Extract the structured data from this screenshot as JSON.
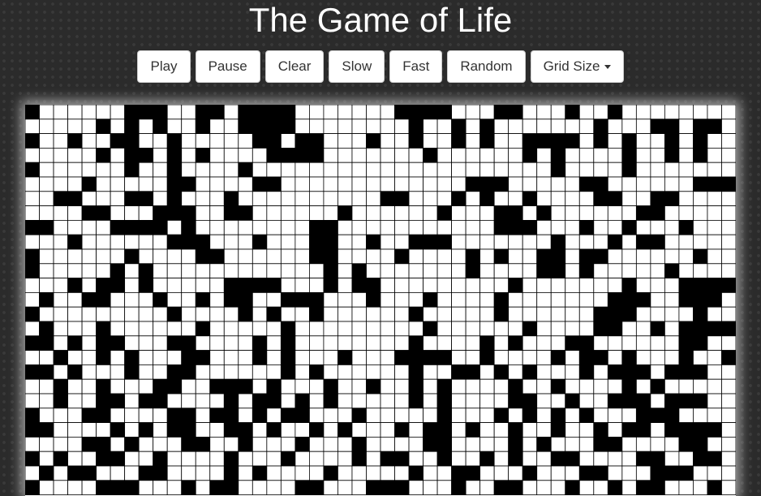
{
  "title": "The Game of Life",
  "toolbar": {
    "play": "Play",
    "pause": "Pause",
    "clear": "Clear",
    "slow": "Slow",
    "fast": "Fast",
    "random": "Random",
    "grid_size": "Grid Size"
  },
  "colors": {
    "background": "#2b2b2b",
    "cell_alive": "#000000",
    "cell_dead": "#ffffff",
    "grid_line": "#000000"
  },
  "board": {
    "cols": 50,
    "visible_rows": 27,
    "alive_cells": [
      [
        0,
        0
      ],
      [
        0,
        7
      ],
      [
        0,
        8
      ],
      [
        0,
        9
      ],
      [
        0,
        12
      ],
      [
        0,
        13
      ],
      [
        0,
        15
      ],
      [
        0,
        16
      ],
      [
        0,
        17
      ],
      [
        0,
        18
      ],
      [
        0,
        26
      ],
      [
        0,
        27
      ],
      [
        0,
        28
      ],
      [
        0,
        29
      ],
      [
        0,
        33
      ],
      [
        0,
        34
      ],
      [
        0,
        38
      ],
      [
        0,
        41
      ],
      [
        1,
        5
      ],
      [
        1,
        7
      ],
      [
        1,
        9
      ],
      [
        1,
        12
      ],
      [
        1,
        15
      ],
      [
        1,
        16
      ],
      [
        1,
        17
      ],
      [
        1,
        18
      ],
      [
        1,
        27
      ],
      [
        1,
        30
      ],
      [
        1,
        32
      ],
      [
        1,
        40
      ],
      [
        1,
        44
      ],
      [
        1,
        45
      ],
      [
        1,
        47
      ],
      [
        1,
        48
      ],
      [
        2,
        0
      ],
      [
        2,
        3
      ],
      [
        2,
        6
      ],
      [
        2,
        7
      ],
      [
        2,
        10
      ],
      [
        2,
        16
      ],
      [
        2,
        17
      ],
      [
        2,
        19
      ],
      [
        2,
        20
      ],
      [
        2,
        24
      ],
      [
        2,
        27
      ],
      [
        2,
        30
      ],
      [
        2,
        32
      ],
      [
        2,
        35
      ],
      [
        2,
        36
      ],
      [
        2,
        37
      ],
      [
        2,
        38
      ],
      [
        2,
        40
      ],
      [
        2,
        42
      ],
      [
        2,
        45
      ],
      [
        2,
        47
      ],
      [
        3,
        5
      ],
      [
        3,
        7
      ],
      [
        3,
        8
      ],
      [
        3,
        10
      ],
      [
        3,
        12
      ],
      [
        3,
        17
      ],
      [
        3,
        18
      ],
      [
        3,
        19
      ],
      [
        3,
        20
      ],
      [
        3,
        28
      ],
      [
        3,
        35
      ],
      [
        3,
        37
      ],
      [
        3,
        42
      ],
      [
        3,
        45
      ],
      [
        3,
        47
      ],
      [
        4,
        0
      ],
      [
        4,
        7
      ],
      [
        4,
        10
      ],
      [
        4,
        15
      ],
      [
        4,
        37
      ],
      [
        4,
        42
      ],
      [
        5,
        4
      ],
      [
        5,
        10
      ],
      [
        5,
        11
      ],
      [
        5,
        16
      ],
      [
        5,
        17
      ],
      [
        5,
        31
      ],
      [
        5,
        32
      ],
      [
        5,
        33
      ],
      [
        5,
        39
      ],
      [
        5,
        40
      ],
      [
        5,
        47
      ],
      [
        5,
        48
      ],
      [
        5,
        49
      ],
      [
        6,
        2
      ],
      [
        6,
        3
      ],
      [
        6,
        7
      ],
      [
        6,
        8
      ],
      [
        6,
        10
      ],
      [
        6,
        14
      ],
      [
        6,
        25
      ],
      [
        6,
        26
      ],
      [
        6,
        30
      ],
      [
        6,
        32
      ],
      [
        6,
        35
      ],
      [
        6,
        40
      ],
      [
        6,
        41
      ],
      [
        6,
        44
      ],
      [
        6,
        45
      ],
      [
        7,
        4
      ],
      [
        7,
        5
      ],
      [
        7,
        9
      ],
      [
        7,
        10
      ],
      [
        7,
        11
      ],
      [
        7,
        14
      ],
      [
        7,
        15
      ],
      [
        7,
        22
      ],
      [
        7,
        29
      ],
      [
        7,
        33
      ],
      [
        7,
        34
      ],
      [
        7,
        36
      ],
      [
        7,
        43
      ],
      [
        7,
        44
      ],
      [
        8,
        0
      ],
      [
        8,
        1
      ],
      [
        8,
        6
      ],
      [
        8,
        7
      ],
      [
        8,
        8
      ],
      [
        8,
        9
      ],
      [
        8,
        11
      ],
      [
        8,
        20
      ],
      [
        8,
        21
      ],
      [
        8,
        33
      ],
      [
        8,
        34
      ],
      [
        8,
        35
      ],
      [
        8,
        39
      ],
      [
        8,
        42
      ],
      [
        8,
        46
      ],
      [
        9,
        3
      ],
      [
        9,
        10
      ],
      [
        9,
        11
      ],
      [
        9,
        12
      ],
      [
        9,
        16
      ],
      [
        9,
        20
      ],
      [
        9,
        21
      ],
      [
        9,
        24
      ],
      [
        9,
        27
      ],
      [
        9,
        28
      ],
      [
        9,
        29
      ],
      [
        9,
        37
      ],
      [
        9,
        41
      ],
      [
        9,
        43
      ],
      [
        9,
        44
      ],
      [
        10,
        0
      ],
      [
        10,
        7
      ],
      [
        10,
        12
      ],
      [
        10,
        13
      ],
      [
        10,
        20
      ],
      [
        10,
        21
      ],
      [
        10,
        26
      ],
      [
        10,
        31
      ],
      [
        10,
        33
      ],
      [
        10,
        36
      ],
      [
        10,
        37
      ],
      [
        10,
        39
      ],
      [
        10,
        40
      ],
      [
        10,
        47
      ],
      [
        11,
        0
      ],
      [
        11,
        6
      ],
      [
        11,
        8
      ],
      [
        11,
        21
      ],
      [
        11,
        23
      ],
      [
        11,
        31
      ],
      [
        11,
        36
      ],
      [
        11,
        37
      ],
      [
        11,
        39
      ],
      [
        11,
        45
      ],
      [
        12,
        3
      ],
      [
        12,
        5
      ],
      [
        12,
        6
      ],
      [
        12,
        8
      ],
      [
        12,
        14
      ],
      [
        12,
        15
      ],
      [
        12,
        16
      ],
      [
        12,
        17
      ],
      [
        12,
        21
      ],
      [
        12,
        23
      ],
      [
        12,
        24
      ],
      [
        12,
        34
      ],
      [
        12,
        42
      ],
      [
        12,
        46
      ],
      [
        12,
        47
      ],
      [
        12,
        48
      ],
      [
        12,
        49
      ],
      [
        13,
        1
      ],
      [
        13,
        4
      ],
      [
        13,
        5
      ],
      [
        13,
        9
      ],
      [
        13,
        12
      ],
      [
        13,
        14
      ],
      [
        13,
        15
      ],
      [
        13,
        18
      ],
      [
        13,
        19
      ],
      [
        13,
        20
      ],
      [
        13,
        24
      ],
      [
        13,
        28
      ],
      [
        13,
        33
      ],
      [
        13,
        41
      ],
      [
        13,
        42
      ],
      [
        13,
        43
      ],
      [
        13,
        46
      ],
      [
        13,
        47
      ],
      [
        13,
        48
      ],
      [
        14,
        0
      ],
      [
        14,
        10
      ],
      [
        14,
        15
      ],
      [
        14,
        17
      ],
      [
        14,
        20
      ],
      [
        14,
        27
      ],
      [
        14,
        33
      ],
      [
        14,
        40
      ],
      [
        14,
        41
      ],
      [
        14,
        42
      ],
      [
        14,
        47
      ],
      [
        15,
        1
      ],
      [
        15,
        5
      ],
      [
        15,
        12
      ],
      [
        15,
        18
      ],
      [
        15,
        28
      ],
      [
        15,
        35
      ],
      [
        15,
        40
      ],
      [
        15,
        41
      ],
      [
        15,
        44
      ],
      [
        15,
        46
      ],
      [
        15,
        47
      ],
      [
        15,
        48
      ],
      [
        15,
        49
      ],
      [
        16,
        0
      ],
      [
        16,
        1
      ],
      [
        16,
        3
      ],
      [
        16,
        5
      ],
      [
        16,
        6
      ],
      [
        16,
        10
      ],
      [
        16,
        11
      ],
      [
        16,
        16
      ],
      [
        16,
        18
      ],
      [
        16,
        27
      ],
      [
        16,
        32
      ],
      [
        16,
        34
      ],
      [
        16,
        38
      ],
      [
        16,
        39
      ],
      [
        16,
        46
      ],
      [
        16,
        47
      ],
      [
        17,
        2
      ],
      [
        17,
        5
      ],
      [
        17,
        7
      ],
      [
        17,
        11
      ],
      [
        17,
        12
      ],
      [
        17,
        16
      ],
      [
        17,
        18
      ],
      [
        17,
        22
      ],
      [
        17,
        26
      ],
      [
        17,
        27
      ],
      [
        17,
        28
      ],
      [
        17,
        29
      ],
      [
        17,
        32
      ],
      [
        17,
        37
      ],
      [
        17,
        39
      ],
      [
        17,
        40
      ],
      [
        17,
        42
      ],
      [
        17,
        46
      ],
      [
        17,
        49
      ],
      [
        18,
        0
      ],
      [
        18,
        1
      ],
      [
        18,
        3
      ],
      [
        18,
        7
      ],
      [
        18,
        10
      ],
      [
        18,
        11
      ],
      [
        18,
        18
      ],
      [
        18,
        20
      ],
      [
        18,
        27
      ],
      [
        18,
        30
      ],
      [
        18,
        31
      ],
      [
        18,
        33
      ],
      [
        18,
        35
      ],
      [
        18,
        39
      ],
      [
        18,
        41
      ],
      [
        18,
        42
      ],
      [
        18,
        43
      ],
      [
        18,
        45
      ],
      [
        18,
        46
      ],
      [
        18,
        47
      ],
      [
        19,
        2
      ],
      [
        19,
        5
      ],
      [
        19,
        9
      ],
      [
        19,
        10
      ],
      [
        19,
        13
      ],
      [
        19,
        14
      ],
      [
        19,
        15
      ],
      [
        19,
        17
      ],
      [
        19,
        21
      ],
      [
        19,
        24
      ],
      [
        19,
        27
      ],
      [
        19,
        29
      ],
      [
        19,
        34
      ],
      [
        19,
        37
      ],
      [
        19,
        42
      ],
      [
        19,
        44
      ],
      [
        20,
        2
      ],
      [
        20,
        5
      ],
      [
        20,
        6
      ],
      [
        20,
        8
      ],
      [
        20,
        9
      ],
      [
        20,
        14
      ],
      [
        20,
        16
      ],
      [
        20,
        17
      ],
      [
        20,
        19
      ],
      [
        20,
        21
      ],
      [
        20,
        27
      ],
      [
        20,
        29
      ],
      [
        20,
        34
      ],
      [
        20,
        35
      ],
      [
        20,
        38
      ],
      [
        20,
        41
      ],
      [
        20,
        42
      ],
      [
        20,
        43
      ],
      [
        20,
        45
      ],
      [
        20,
        46
      ],
      [
        20,
        47
      ],
      [
        21,
        0
      ],
      [
        21,
        4
      ],
      [
        21,
        5
      ],
      [
        21,
        10
      ],
      [
        21,
        11
      ],
      [
        21,
        13
      ],
      [
        21,
        14
      ],
      [
        21,
        16
      ],
      [
        21,
        18
      ],
      [
        21,
        19
      ],
      [
        21,
        23
      ],
      [
        21,
        29
      ],
      [
        21,
        33
      ],
      [
        21,
        35
      ],
      [
        21,
        37
      ],
      [
        21,
        39
      ],
      [
        21,
        43
      ],
      [
        21,
        44
      ],
      [
        21,
        45
      ],
      [
        22,
        0
      ],
      [
        22,
        1
      ],
      [
        22,
        6
      ],
      [
        22,
        8
      ],
      [
        22,
        10
      ],
      [
        22,
        11
      ],
      [
        22,
        14
      ],
      [
        22,
        15
      ],
      [
        22,
        17
      ],
      [
        22,
        20
      ],
      [
        22,
        22
      ],
      [
        22,
        26
      ],
      [
        22,
        28
      ],
      [
        22,
        29
      ],
      [
        22,
        31
      ],
      [
        22,
        34
      ],
      [
        22,
        37
      ],
      [
        22,
        40
      ],
      [
        22,
        42
      ],
      [
        22,
        43
      ],
      [
        22,
        45
      ],
      [
        22,
        46
      ],
      [
        22,
        47
      ],
      [
        22,
        48
      ],
      [
        23,
        4
      ],
      [
        23,
        5
      ],
      [
        23,
        7
      ],
      [
        23,
        11
      ],
      [
        23,
        12
      ],
      [
        23,
        15
      ],
      [
        23,
        19
      ],
      [
        23,
        23
      ],
      [
        23,
        28
      ],
      [
        23,
        29
      ],
      [
        23,
        34
      ],
      [
        23,
        36
      ],
      [
        23,
        40
      ],
      [
        23,
        41
      ],
      [
        23,
        46
      ],
      [
        23,
        47
      ],
      [
        24,
        0
      ],
      [
        24,
        2
      ],
      [
        24,
        5
      ],
      [
        24,
        6
      ],
      [
        24,
        9
      ],
      [
        24,
        14
      ],
      [
        24,
        18
      ],
      [
        24,
        23
      ],
      [
        24,
        25
      ],
      [
        24,
        26
      ],
      [
        24,
        29
      ],
      [
        24,
        32
      ],
      [
        24,
        34
      ],
      [
        24,
        37
      ],
      [
        24,
        38
      ],
      [
        24,
        43
      ],
      [
        24,
        44
      ],
      [
        24,
        47
      ],
      [
        24,
        48
      ],
      [
        25,
        1
      ],
      [
        25,
        3
      ],
      [
        25,
        4
      ],
      [
        25,
        8
      ],
      [
        25,
        9
      ],
      [
        25,
        14
      ],
      [
        25,
        16
      ],
      [
        25,
        21
      ],
      [
        25,
        27
      ],
      [
        25,
        30
      ],
      [
        25,
        31
      ],
      [
        25,
        35
      ],
      [
        25,
        39
      ],
      [
        25,
        40
      ],
      [
        25,
        44
      ],
      [
        25,
        45
      ],
      [
        25,
        46
      ],
      [
        26,
        0
      ],
      [
        26,
        5
      ],
      [
        26,
        6
      ],
      [
        26,
        7
      ],
      [
        26,
        11
      ],
      [
        26,
        13
      ],
      [
        26,
        14
      ],
      [
        26,
        19
      ],
      [
        26,
        20
      ],
      [
        26,
        24
      ],
      [
        26,
        25
      ],
      [
        26,
        26
      ],
      [
        26,
        30
      ],
      [
        26,
        33
      ],
      [
        26,
        34
      ],
      [
        26,
        38
      ],
      [
        26,
        41
      ],
      [
        26,
        43
      ],
      [
        26,
        44
      ],
      [
        26,
        48
      ]
    ]
  }
}
